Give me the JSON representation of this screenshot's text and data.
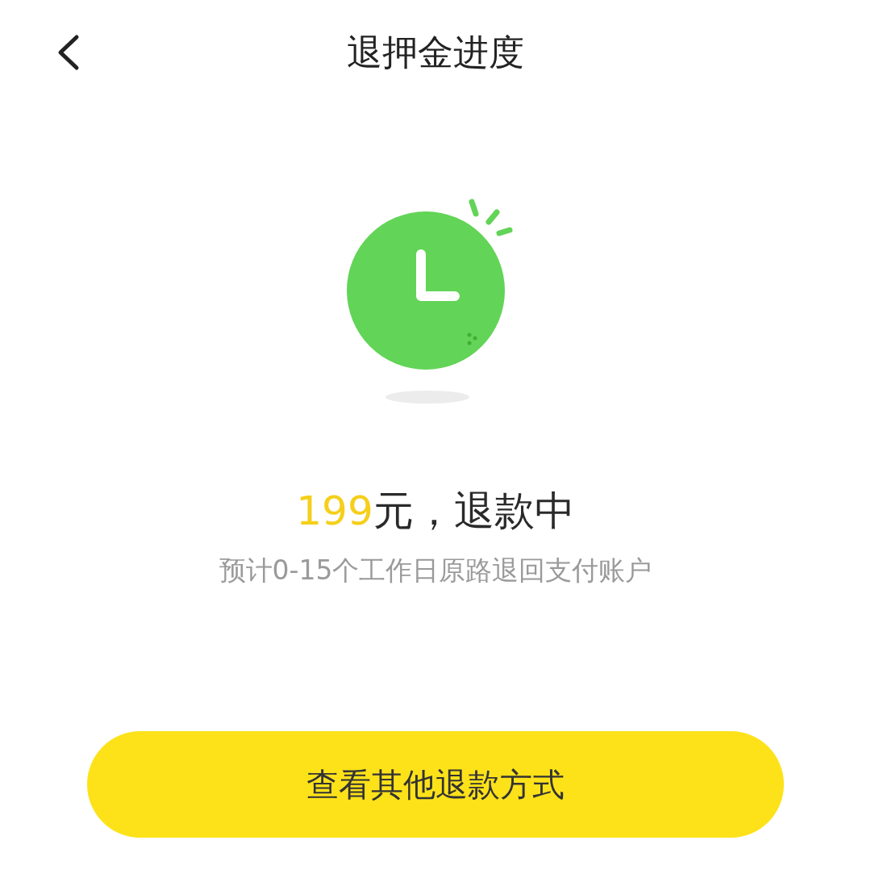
{
  "header": {
    "title": "退押金进度"
  },
  "status": {
    "amount": "199",
    "label": "元，退款中",
    "note": "预计0-15个工作日原路退回支付账户"
  },
  "button": {
    "label": "查看其他退款方式"
  }
}
